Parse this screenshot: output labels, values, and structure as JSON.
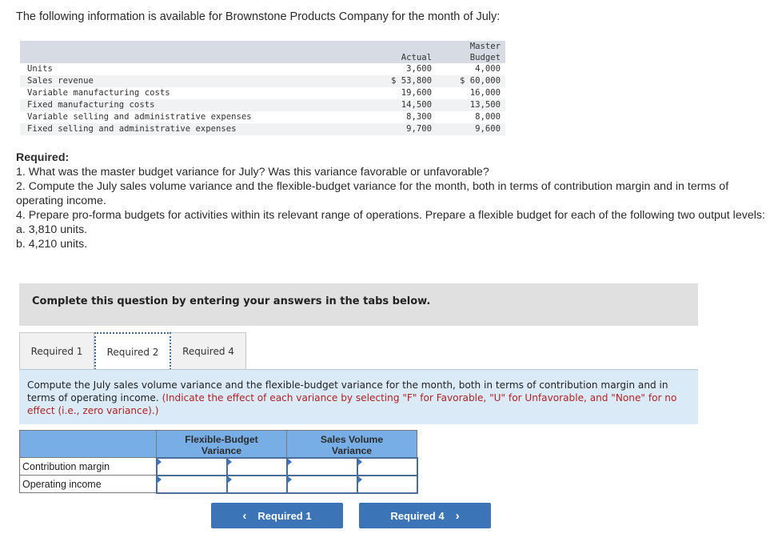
{
  "intro": "The following information is available for Brownstone Products Company for the month of July:",
  "data_table": {
    "headers": {
      "actual": "Actual",
      "master_line1": "Master",
      "master_line2": "Budget"
    },
    "rows": [
      {
        "label": "Units",
        "actual": "3,600",
        "master": "4,000"
      },
      {
        "label": "Sales revenue",
        "actual": "$ 53,800",
        "master": "$ 60,000"
      },
      {
        "label": "Variable manufacturing costs",
        "actual": "19,600",
        "master": "16,000"
      },
      {
        "label": "Fixed manufacturing costs",
        "actual": "14,500",
        "master": "13,500"
      },
      {
        "label": "Variable selling and administrative expenses",
        "actual": "8,300",
        "master": "8,000"
      },
      {
        "label": "Fixed selling and administrative expenses",
        "actual": "9,700",
        "master": "9,600"
      }
    ]
  },
  "required": {
    "heading": "Required:",
    "items": [
      "1. What was the master budget variance for July? Was this variance favorable or unfavorable?",
      "2. Compute the July sales volume variance and the flexible-budget variance for the month, both in terms of contribution margin and in terms of operating income.",
      "4. Prepare pro-forma budgets for activities within its relevant range of operations. Prepare a flexible budget for each of the following two output levels:",
      "a. 3,810 units.",
      "b. 4,210 units."
    ]
  },
  "instructions": "Complete this question by entering your answers in the tabs below.",
  "tabs": [
    {
      "label": "Required 1",
      "active": false
    },
    {
      "label": "Required 2",
      "active": true
    },
    {
      "label": "Required 4",
      "active": false
    }
  ],
  "prompt": {
    "text": "Compute the July sales volume variance and the flexible-budget variance for the month, both in terms of contribution margin and in terms of operating income.",
    "note": "(Indicate the effect of each variance by selecting \"F\" for Favorable, \"U\" for Unfavorable, and \"None\" for no effect (i.e., zero variance).)"
  },
  "answer_table": {
    "headers": {
      "flexible_line1": "Flexible-Budget",
      "flexible_line2": "Variance",
      "sales_line1": "Sales Volume",
      "sales_line2": "Variance"
    },
    "rows": [
      {
        "label": "Contribution margin",
        "flex_amount": "",
        "flex_effect": "",
        "sales_amount": "",
        "sales_effect": ""
      },
      {
        "label": "Operating income",
        "flex_amount": "",
        "flex_effect": "",
        "sales_amount": "",
        "sales_effect": ""
      }
    ]
  },
  "nav": {
    "prev_label": "Required 1",
    "prev_icon": "‹",
    "next_label": "Required 4",
    "next_icon": "›"
  },
  "colors": {
    "button": "#3b74b7",
    "header_blue": "#78aee6",
    "prompt_bg": "#daeaf7",
    "note_red": "#b22222"
  }
}
